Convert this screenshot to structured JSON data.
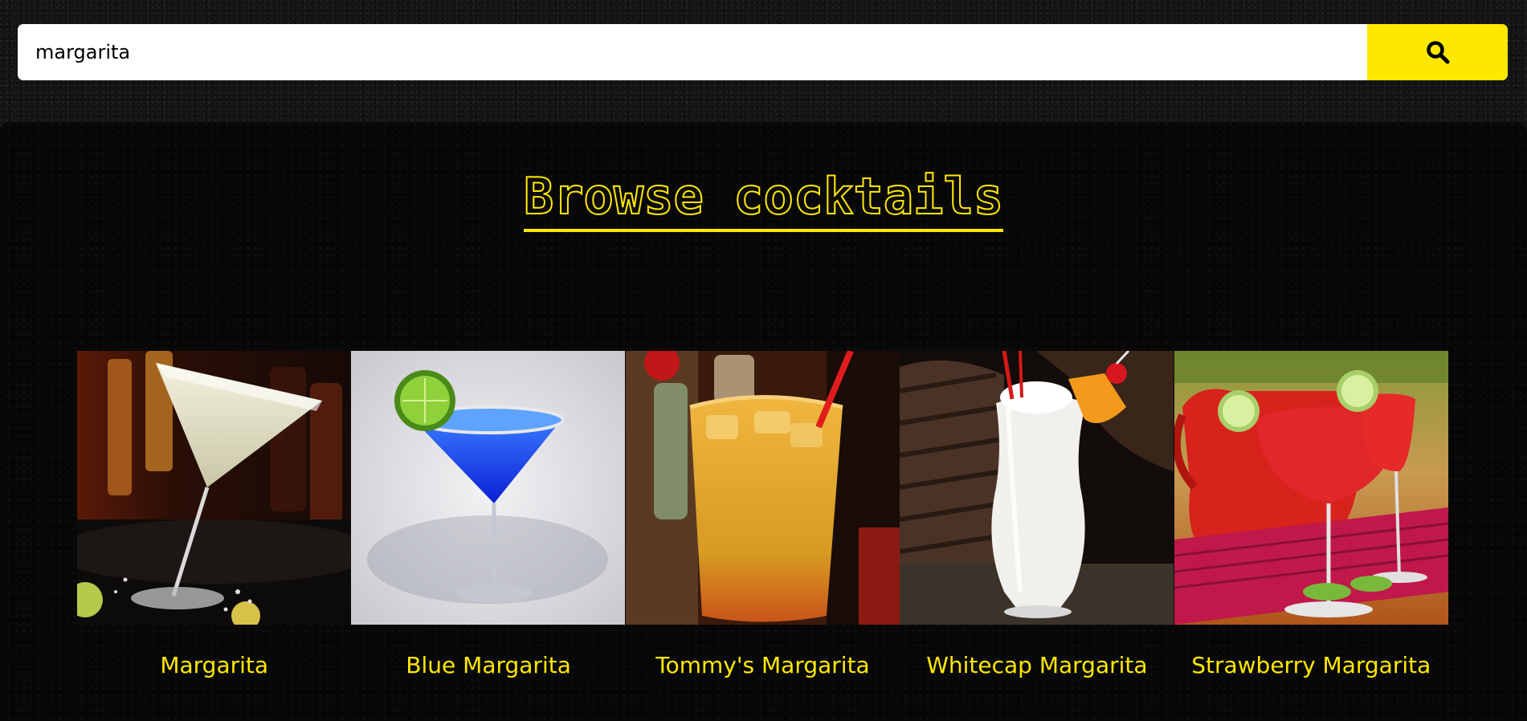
{
  "search": {
    "value": "margarita",
    "icon": "search-icon"
  },
  "page": {
    "title": "Browse cocktails"
  },
  "colors": {
    "accent": "#ffe800",
    "panel": "#070707",
    "input_background": "#ffffff"
  },
  "cocktails": [
    {
      "name": "Margarita",
      "image": "margarita-photo"
    },
    {
      "name": "Blue Margarita",
      "image": "blue-margarita-photo"
    },
    {
      "name": "Tommy's Margarita",
      "image": "tommys-margarita-photo"
    },
    {
      "name": "Whitecap Margarita",
      "image": "whitecap-margarita-photo"
    },
    {
      "name": "Strawberry Margarita",
      "image": "strawberry-margarita-photo"
    }
  ]
}
